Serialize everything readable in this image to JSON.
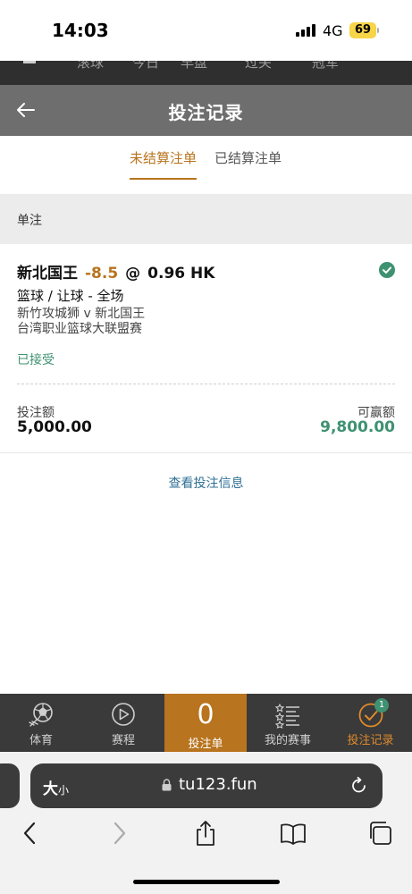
{
  "status_bar": {
    "time": "14:03",
    "network": "4G",
    "battery": "69"
  },
  "site_menu": {
    "items": [
      "滚球",
      "今日",
      "早盘",
      "过关",
      "冠军"
    ]
  },
  "header": {
    "title": "投注记录"
  },
  "tabs": [
    {
      "label": "未结算注单",
      "active": true
    },
    {
      "label": "已结算注单",
      "active": false
    }
  ],
  "section": {
    "label": "单注"
  },
  "bet": {
    "selection": "新北国王",
    "handicap": "-8.5",
    "at": "@",
    "odds": "0.96 HK",
    "market": "篮球 / 让球 - 全场",
    "match": "新竹攻城狮 v 新北国王",
    "league": "台湾职业篮球大联盟赛",
    "status": "已接受",
    "stake_label": "投注额",
    "stake_value": "5,000.00",
    "win_label": "可赢额",
    "win_value": "9,800.00",
    "accent_color": "#b8741e",
    "win_color": "#3e9271"
  },
  "view_info": "查看投注信息",
  "bottom_nav": {
    "items": [
      {
        "label": "体育",
        "icon": "soccer-ball-icon"
      },
      {
        "label": "赛程",
        "icon": "play-circle-icon"
      },
      {
        "label": "投注单",
        "icon": "betslip-count",
        "count": "0"
      },
      {
        "label": "我的赛事",
        "icon": "star-list-icon"
      },
      {
        "label": "投注记录",
        "icon": "check-circle-icon",
        "badge": "1"
      }
    ]
  },
  "browser": {
    "text_size_label": "大",
    "text_size_small": "小",
    "url": "tu123.fun"
  }
}
